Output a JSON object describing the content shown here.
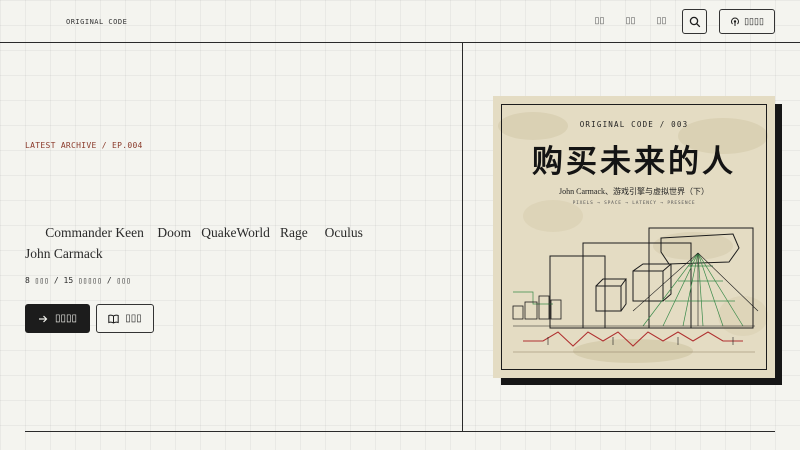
{
  "header": {
    "brand": "ORIGINAL CODE",
    "nav": [
      "▯▯",
      "▯▯",
      "▯▯"
    ],
    "subscribe_label": "▯▯▯▯"
  },
  "hero": {
    "eyebrow": "LATEST ARCHIVE / EP.004",
    "tagline": "      Commander Keen    Doom   QuakeWorld   Rage     Oculus         John Carmack",
    "stats": "8 ▯▯▯ / 15 ▯▯▯▯▯ / ▯▯▯",
    "primary_label": "▯▯▯▯",
    "secondary_label": "▯▯▯"
  },
  "cover": {
    "kicker": "ORIGINAL CODE  /  003",
    "title": "购买未来的人",
    "subtitle": "John Carmack、游戏引擎与虚拟世界（下）",
    "tags": "PIXELS  →  SPACE  →  LATENCY  →  PRESENCE"
  },
  "colors": {
    "background": "#f4f4ef",
    "ink": "#1c1c1c",
    "accent_red": "#8a3a2a",
    "cover_paper": "#e4dcc3",
    "cover_green": "#3a8a4a",
    "cover_red": "#b03030"
  },
  "icons": {
    "search": "search-icon",
    "subscribe": "podcast-icon",
    "play": "arrow-right-icon",
    "read": "book-icon"
  }
}
